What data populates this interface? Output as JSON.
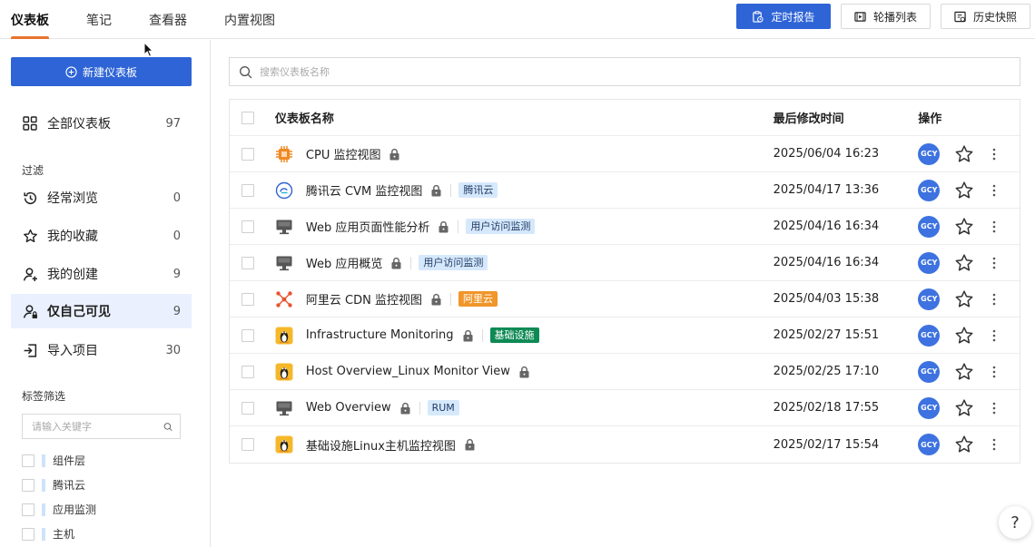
{
  "nav": {
    "tabs": [
      {
        "label": "仪表板",
        "active": true
      },
      {
        "label": "笔记"
      },
      {
        "label": "查看器"
      },
      {
        "label": "内置视图"
      }
    ]
  },
  "toolbar": {
    "scheduled_report": "定时报告",
    "carousel_list": "轮播列表",
    "history_snapshot": "历史快照"
  },
  "sidebar": {
    "new_dashboard": "新建仪表板",
    "all": {
      "label": "全部仪表板",
      "count": "97"
    },
    "filter_title": "过滤",
    "filters": [
      {
        "label": "经常浏览",
        "count": "0",
        "icon": "history-icon"
      },
      {
        "label": "我的收藏",
        "count": "0",
        "icon": "star-outline-icon"
      },
      {
        "label": "我的创建",
        "count": "9",
        "icon": "user-add-icon"
      },
      {
        "label": "仅自己可见",
        "count": "9",
        "icon": "user-lock-icon",
        "selected": true
      },
      {
        "label": "导入项目",
        "count": "30",
        "icon": "import-icon"
      }
    ],
    "tag_title": "标签筛选",
    "tag_placeholder": "请输入关键字",
    "tags": [
      "组件层",
      "腾讯云",
      "应用监测",
      "主机"
    ]
  },
  "main": {
    "search_placeholder": "搜索仪表板名称",
    "columns": {
      "name": "仪表板名称",
      "time": "最后修改时间",
      "ops": "操作"
    },
    "rows": [
      {
        "name": "CPU 监控视图",
        "time": "2025/06/04 16:23",
        "icon": "cpu-icon",
        "tag": null
      },
      {
        "name": "腾讯云 CVM 监控视图",
        "time": "2025/04/17 13:36",
        "icon": "tencent-cloud-icon",
        "tag": {
          "label": "腾讯云",
          "bg": "#d6e8fb",
          "fg": "#1f3b66"
        }
      },
      {
        "name": "Web 应用页面性能分析",
        "time": "2025/04/16 16:34",
        "icon": "monitor-icon",
        "tag": {
          "label": "用户访问监测",
          "bg": "#d6e8fb",
          "fg": "#1f3b66"
        }
      },
      {
        "name": "Web 应用概览",
        "time": "2025/04/16 16:34",
        "icon": "monitor-icon",
        "tag": {
          "label": "用户访问监测",
          "bg": "#d6e8fb",
          "fg": "#1f3b66"
        }
      },
      {
        "name": "阿里云 CDN 监控视图",
        "time": "2025/04/03 15:38",
        "icon": "aliyun-cdn-icon",
        "tag": {
          "label": "阿里云",
          "bg": "#f0962a",
          "fg": "#ffffff"
        }
      },
      {
        "name": "Infrastructure Monitoring",
        "time": "2025/02/27 15:51",
        "icon": "linux-icon",
        "tag": {
          "label": "基础设施",
          "bg": "#0e8a55",
          "fg": "#ffffff"
        }
      },
      {
        "name": "Host Overview_Linux Monitor View",
        "time": "2025/02/25 17:10",
        "icon": "linux-icon",
        "tag": null
      },
      {
        "name": "Web Overview",
        "time": "2025/02/18 17:55",
        "icon": "monitor-icon",
        "tag": {
          "label": "RUM",
          "bg": "#d6e8fb",
          "fg": "#1f3b66"
        }
      },
      {
        "name": "基础设施Linux主机监控视图",
        "time": "2025/02/17 15:54",
        "icon": "linux-icon",
        "tag": null
      }
    ],
    "owner_initials": "GCY"
  },
  "help_label": "?",
  "colors": {
    "primary": "#2e64d6",
    "accent": "#e8742c",
    "avatar": "#3d72e0"
  }
}
